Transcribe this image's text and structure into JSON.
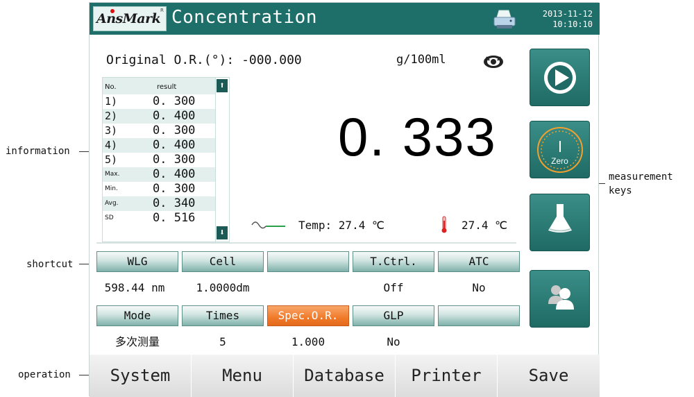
{
  "callouts": {
    "information": "information",
    "shortcut": "shortcut",
    "operation": "operation",
    "measurement_keys_line1": "measurement",
    "measurement_keys_line2": "keys"
  },
  "header": {
    "logo": "AnsMark",
    "logo_reg": "R",
    "title": "Concentration",
    "date": "2013-11-12",
    "time": "10:10:10",
    "printer_icon": "printer-icon"
  },
  "measurement": {
    "original_or": "Original O.R.(°): -000.000",
    "unit": "g/100ml",
    "reading": "0. 333",
    "temp_label": "Temp: 27.4 ℃",
    "temp_right": "27.4 ℃"
  },
  "results": {
    "header_no": "No.",
    "header_result": "result",
    "rows": [
      {
        "label": "1)",
        "value": "0. 300"
      },
      {
        "label": "2)",
        "value": "0. 400"
      },
      {
        "label": "3)",
        "value": "0. 300"
      },
      {
        "label": "4)",
        "value": "0. 400"
      },
      {
        "label": "5)",
        "value": "0. 300"
      },
      {
        "label": "Max.",
        "value": "0. 400"
      },
      {
        "label": "Min.",
        "value": "0. 300"
      },
      {
        "label": "Avg.",
        "value": "0. 340"
      },
      {
        "label": "SD",
        "value": "0. 516"
      }
    ],
    "scroll_up": "⬆",
    "scroll_down": "⬇"
  },
  "shortcuts_row1": {
    "buttons": [
      "WLG",
      "Cell",
      "",
      "T.Ctrl.",
      "ATC"
    ],
    "values": [
      "598.44 nm",
      "1.0000dm",
      "",
      "Off",
      "No"
    ]
  },
  "shortcuts_row2": {
    "buttons": [
      "Mode",
      "Times",
      "Spec.O.R.",
      "GLP",
      ""
    ],
    "values": [
      "多次测量",
      "5",
      "1.000",
      "No",
      ""
    ]
  },
  "measurement_keys": {
    "zero_label": "Zero"
  },
  "operation": {
    "buttons": [
      "System",
      "Menu",
      "Database",
      "Printer",
      "Save"
    ]
  },
  "colors": {
    "titlebar": "#1e6f69",
    "key_teal": "#1f6a64",
    "active_orange": "#f07a2a"
  }
}
